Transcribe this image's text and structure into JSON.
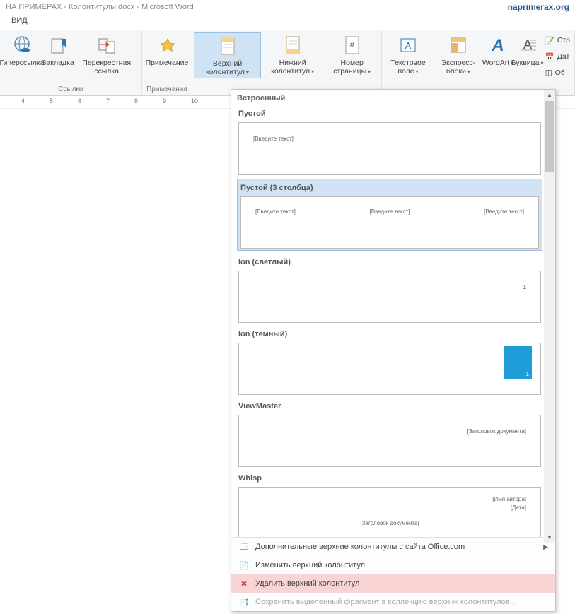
{
  "window": {
    "title": "НА ПРИМЕРАХ - Колонтитулы.docx - Microsoft Word",
    "brand": "naprimerax.org"
  },
  "tab": {
    "view": "ВИД"
  },
  "ribbon": {
    "hyperlink": "Гиперссылка",
    "bookmark": "Закладка",
    "crossref": "Перекрестная ссылка",
    "comment": "Примечание",
    "header": "Верхний колонтитул",
    "footer": "Нижний колонтитул",
    "pagenum": "Номер страницы",
    "textbox": "Текстовое поле",
    "quick": "Экспресс-блоки",
    "wordart": "WordArt",
    "dropcap": "Буквица",
    "sig": "Стр",
    "date": "Дат",
    "obj": "Об",
    "grp_links": "Ссылки",
    "grp_comments": "Примечания"
  },
  "ruler": {
    "n4": "4",
    "n5": "5",
    "n6": "6",
    "n7": "7",
    "n8": "8",
    "n9": "9",
    "n10": "10"
  },
  "gallery": {
    "section": "Встроенный",
    "items": [
      {
        "label": "Пустой",
        "ph": "[Введите текст]"
      },
      {
        "label": "Пустой (3 столбца)",
        "ph": "[Введите текст]"
      },
      {
        "label": "Ion (светлый)",
        "num": "1"
      },
      {
        "label": "Ion (темный)",
        "num": "1"
      },
      {
        "label": "ViewMaster",
        "ph": "[Заголовок документа]"
      },
      {
        "label": "Whisp",
        "auth": "[Имя автора]",
        "date": "[Дата]",
        "title": "[Заголовок документа]"
      }
    ],
    "footer": {
      "more": "Дополнительные верхние колонтитулы с сайта Office.com",
      "edit": "Изменить верхний колонтитул",
      "del": "Удалить верхний колонтитул",
      "save": "Сохранить выделенный фрагмент в коллекцию верхних колонтитулов…"
    }
  }
}
